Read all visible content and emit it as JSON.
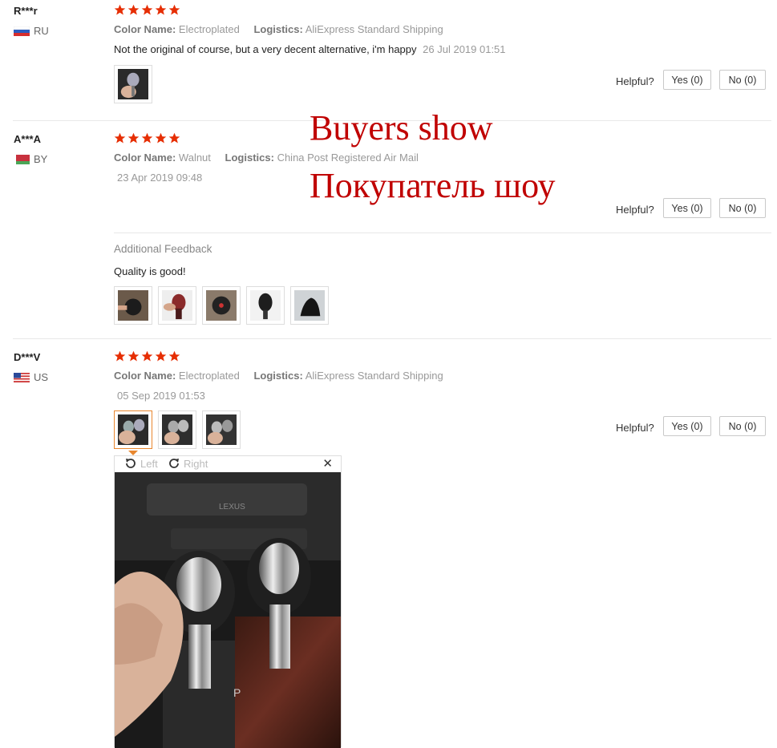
{
  "reviews": [
    {
      "user": "R***r",
      "country": "RU",
      "color_label": "Color Name:",
      "color_value": "Electroplated",
      "logistics_label": "Logistics:",
      "logistics_value": "AliExpress Standard Shipping",
      "text": "Not the original of course, but a very decent alternative, i'm happy",
      "date": "26 Jul 2019 01:51",
      "helpful_label": "Helpful?",
      "yes_label": "Yes (0)",
      "no_label": "No (0)"
    },
    {
      "user": "A***A",
      "country": "BY",
      "color_label": "Color Name:",
      "color_value": "Walnut",
      "logistics_label": "Logistics:",
      "logistics_value": "China Post Registered Air Mail",
      "date": "23 Apr 2019 09:48",
      "helpful_label": "Helpful?",
      "yes_label": "Yes (0)",
      "no_label": "No (0)",
      "additional_title": "Additional Feedback",
      "additional_text": "Quality is good!"
    },
    {
      "user": "D***V",
      "country": "US",
      "color_label": "Color Name:",
      "color_value": "Electroplated",
      "logistics_label": "Logistics:",
      "logistics_value": "AliExpress Standard Shipping",
      "date": "05 Sep 2019 01:53",
      "helpful_label": "Helpful?",
      "yes_label": "Yes (0)",
      "no_label": "No (0)"
    }
  ],
  "overlay": {
    "line1": "Buyers show",
    "line2": "Покупатель шоу"
  },
  "viewer": {
    "left_label": "Left",
    "right_label": "Right",
    "close_label": "✕",
    "photo_text": "LEXUS"
  },
  "colors": {
    "star": "#e62e04",
    "overlay": "#c00000",
    "selected_thumb": "#e8872f"
  }
}
